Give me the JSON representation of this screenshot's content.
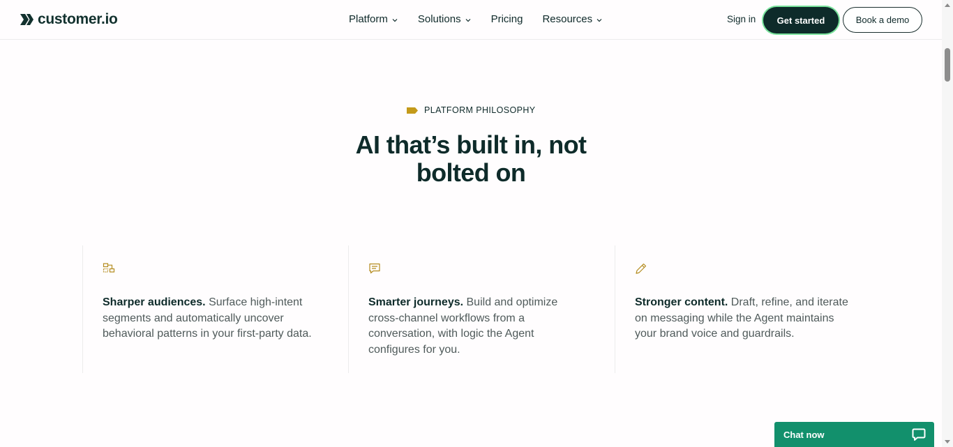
{
  "brand": {
    "name": "customer.io"
  },
  "nav": {
    "items": [
      {
        "label": "Platform",
        "has_menu": true
      },
      {
        "label": "Solutions",
        "has_menu": true
      },
      {
        "label": "Pricing",
        "has_menu": false
      },
      {
        "label": "Resources",
        "has_menu": true
      }
    ],
    "sign_in": "Sign in",
    "get_started": "Get started",
    "book_demo": "Book a demo"
  },
  "hero": {
    "eyebrow": "PLATFORM PHILOSOPHY",
    "headline_line1": "AI that’s built in, not",
    "headline_line2": "bolted on"
  },
  "features": [
    {
      "icon": "audience-segments-icon",
      "title": "Sharper audiences.",
      "body": " Surface high-intent segments and automatically uncover behavioral patterns in your first-party data."
    },
    {
      "icon": "chat-message-icon",
      "title": "Smarter journeys.",
      "body": " Build and optimize cross-channel workflows from a conversation, with logic the Agent configures for you."
    },
    {
      "icon": "pencil-icon",
      "title": "Stronger content.",
      "body": " Draft, refine, and iterate on messaging while the Agent maintains your brand voice and guardrails."
    }
  ],
  "chat": {
    "label": "Chat now"
  },
  "colors": {
    "primary": "#0e2b2a",
    "accent_green": "#79e39c",
    "chat_green": "#12906c",
    "icon_gold": "#b38b1d"
  }
}
